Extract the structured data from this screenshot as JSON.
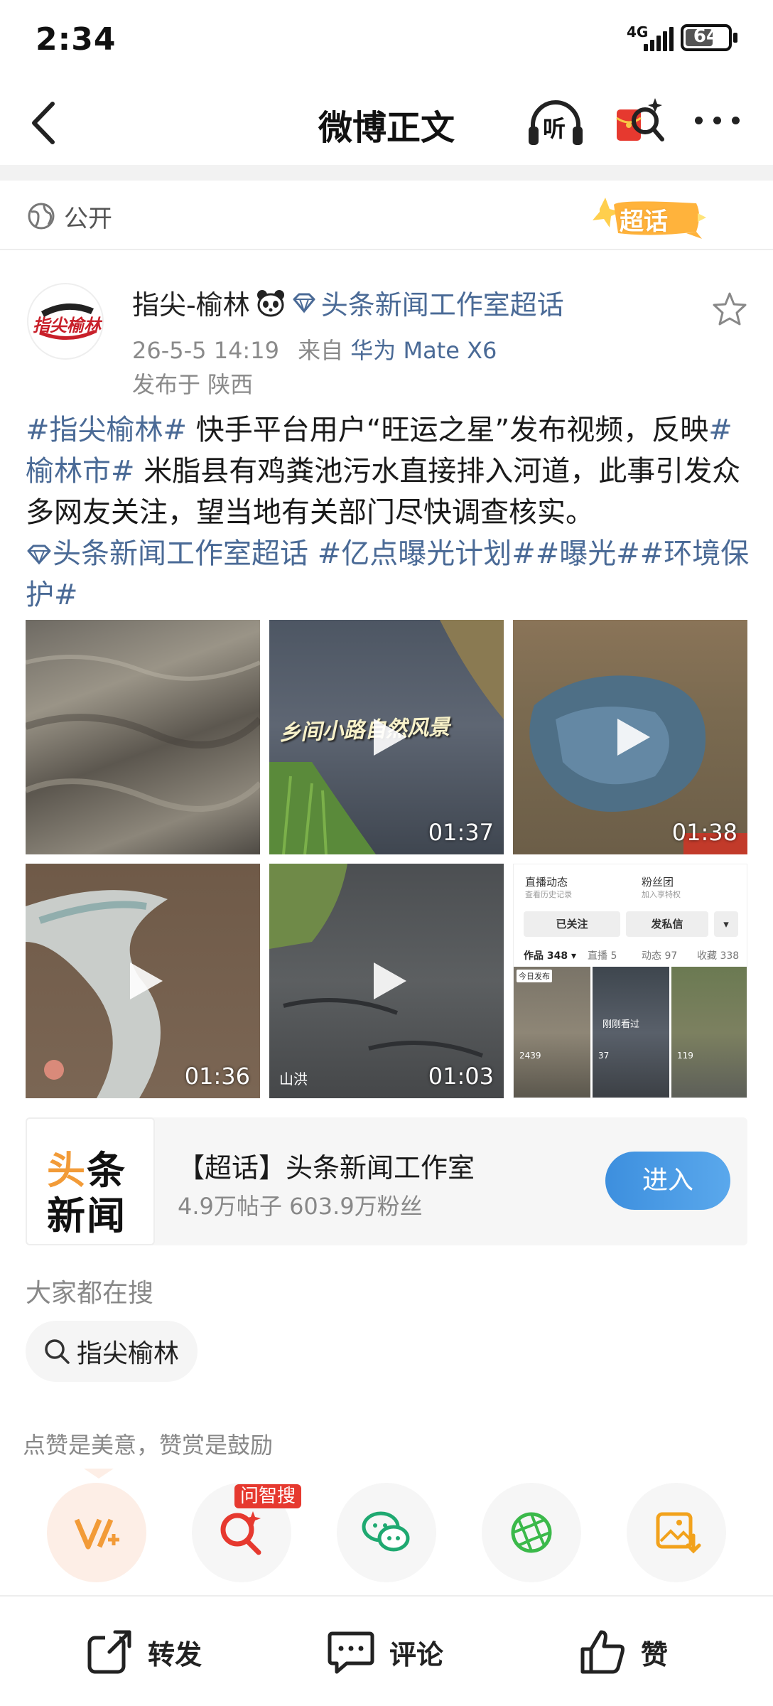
{
  "status_bar": {
    "time": "2:34",
    "network": "4G",
    "battery": "64"
  },
  "nav": {
    "title": "微博正文",
    "listen_label": "听"
  },
  "visibility": {
    "label": "公开",
    "chaohua_badge": "超话"
  },
  "author": {
    "name": "指尖-榆林",
    "avatar_text": "指尖榆林",
    "topic": "头条新闻工作室超话",
    "timestamp": "26-5-5 14:19",
    "source_prefix": "来自",
    "source": "华为 Mate X6",
    "location": "发布于 陕西"
  },
  "post": {
    "tag1": "#指尖榆林#",
    "text1": " 快手平台用户“旺运之星”发布视频，反映",
    "tag2": "#榆林市#",
    "text2": " 米脂县有鸡粪池污水直接排入河道，此事引发众多网友关注，望当地有关部门尽快调查核实。",
    "tag3": "头条新闻工作室超话",
    "tag4": " #亿点曝光计划##曝光##环境保护#"
  },
  "media": {
    "tile2_caption": "乡间小路自然风景",
    "tile2_duration": "01:37",
    "tile3_duration": "01:38",
    "tile4_duration": "01:36",
    "tile5_duration": "01:03",
    "tile5_label": "山洪",
    "tile6": {
      "live": "直播动态",
      "live_sub": "查看历史记录",
      "fans": "粉丝团",
      "fans_sub": "加入享特权",
      "followed": "已关注",
      "message": "发私信",
      "works": "作品 348 ▾",
      "streams": "直播 5",
      "dynamics": "动态 97",
      "favorites": "收藏 338",
      "today": "今日发布",
      "just_watched": "刚刚看过",
      "likes_a": "2439",
      "likes_b": "37",
      "likes_c": "119"
    }
  },
  "topic_card": {
    "thumb_line1": "头条",
    "thumb_line2": "新闻",
    "title": "【超话】头条新闻工作室",
    "stats": "4.9万帖子 603.9万粉丝",
    "enter_label": "进入"
  },
  "search": {
    "header": "大家都在搜",
    "chip": "指尖榆林"
  },
  "reward": {
    "text": "点赞是美意，赞赏是鼓励",
    "badge": "问智搜"
  },
  "bottom_bar": {
    "repost": "转发",
    "comment": "评论",
    "like": "赞"
  },
  "colors": {
    "link": "#4a6a96",
    "accent_blue": "#3d8fde",
    "badge_red": "#e6392f",
    "orange": "#f29b38"
  }
}
